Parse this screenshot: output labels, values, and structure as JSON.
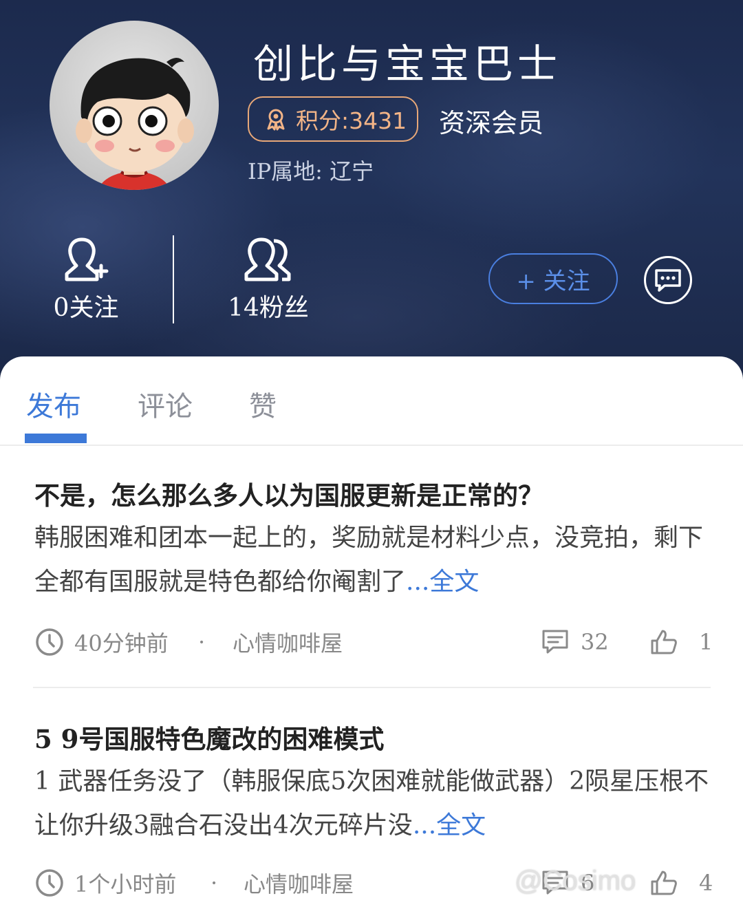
{
  "profile": {
    "username": "创比与宝宝巴士",
    "points": "积分:3431",
    "member_level": "资深会员",
    "ip_location": "IP属地: 辽宁",
    "following": "0关注",
    "fans": "14粉丝",
    "follow_button": "+ 关注"
  },
  "tabs": [
    "发布",
    "评论",
    "赞"
  ],
  "posts": [
    {
      "title": "不是，怎么那么多人以为国服更新是正常的？",
      "body": "韩服困难和团本一起上的，奖励就是材料少点，没竞拍，剩下全都有国服就是特色都给你阉割了",
      "read_more": "...全文",
      "time": "40分钟前",
      "dot": "·",
      "board": "心情咖啡屋",
      "comments": "32",
      "likes": "1"
    },
    {
      "title": "5 9号国服特色魔改的困难模式",
      "body": "1 武器任务没了（韩服保底5次困难就能做武器）2陨星压根不让你升级3融合石没出4次元碎片没",
      "read_more": "...全文",
      "time": "1个小时前",
      "dot": "·",
      "board": "心情咖啡屋",
      "comments": "6",
      "likes": "4"
    }
  ],
  "watermark": "@Cosimo",
  "colors": {
    "accent": "#3d79d8",
    "badge": "#e8a878",
    "header_bg": "#1f2d52"
  },
  "icons": {
    "points": "medal-icon",
    "following": "person-add-icon",
    "fans": "people-icon",
    "message": "chat-bubble-icon",
    "time": "clock-icon",
    "comments": "comment-icon",
    "likes": "thumbs-up-icon"
  }
}
